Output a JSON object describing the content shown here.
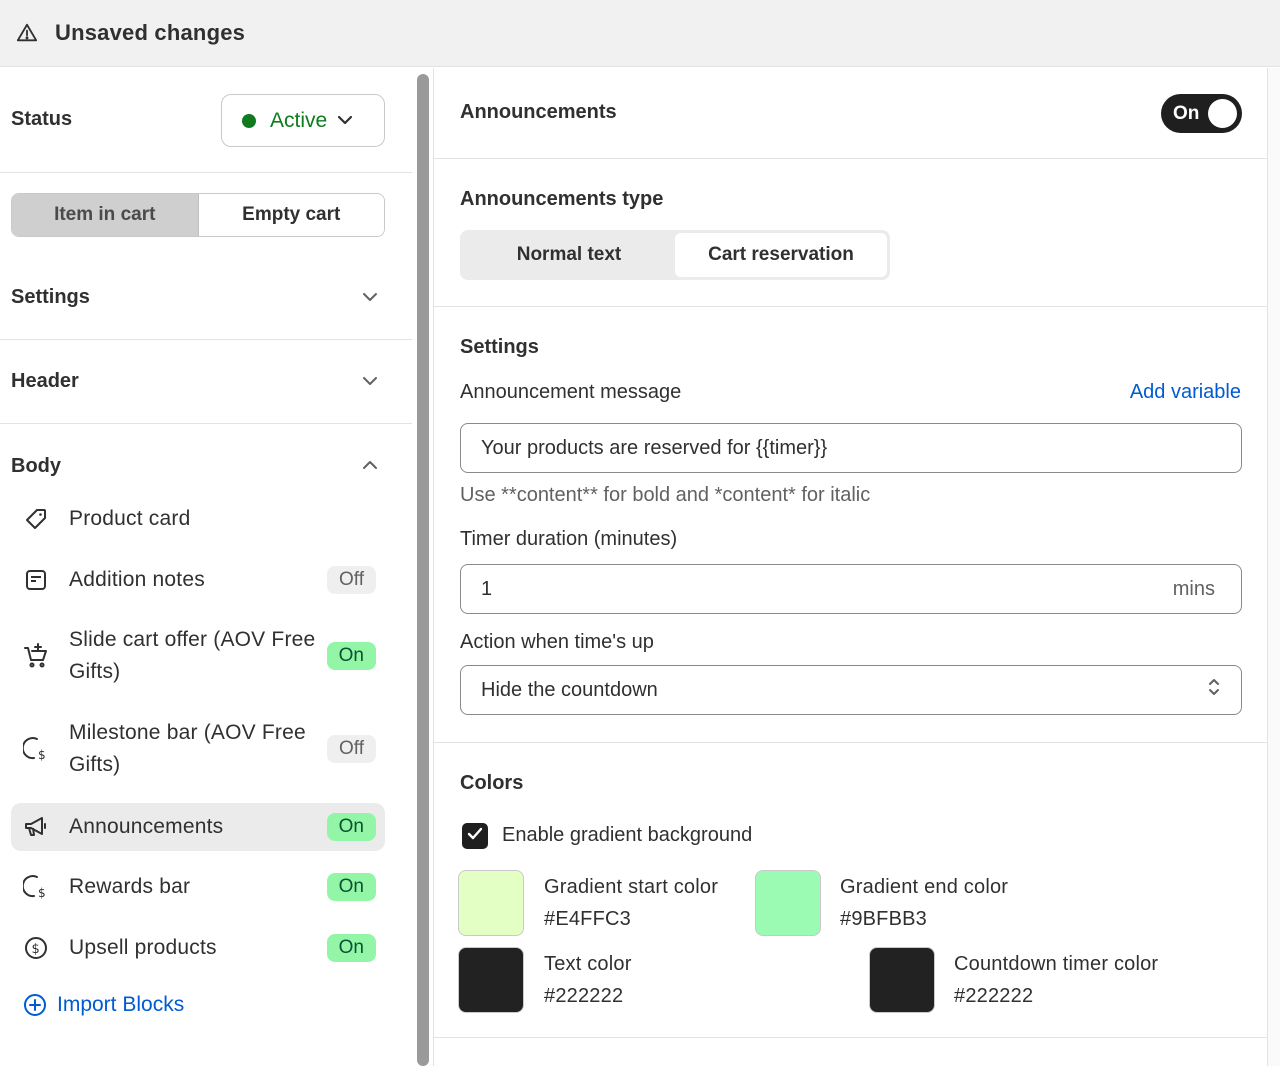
{
  "topbar": {
    "title": "Unsaved changes",
    "icon": "warning-icon"
  },
  "left": {
    "status": {
      "label": "Status",
      "value": "Active",
      "color": "#0e7c1e"
    },
    "cart_tabs": [
      {
        "label": "Item in cart",
        "active": true
      },
      {
        "label": "Empty cart",
        "active": false
      }
    ],
    "sections": {
      "settings": "Settings",
      "header": "Header",
      "body": "Body"
    },
    "items": [
      {
        "label": "Product card",
        "badge": "",
        "icon": "tag-icon"
      },
      {
        "label": "Addition notes",
        "badge": "Off",
        "icon": "note-icon"
      },
      {
        "label": "Slide cart offer (AOV Free Gifts)",
        "badge": "On",
        "icon": "cart-offer-icon"
      },
      {
        "label": "Milestone bar (AOV Free Gifts)",
        "badge": "Off",
        "icon": "milestone-icon"
      },
      {
        "label": "Announcements",
        "badge": "On",
        "icon": "megaphone-icon"
      },
      {
        "label": "Rewards bar",
        "badge": "On",
        "icon": "rewards-icon"
      },
      {
        "label": "Upsell products",
        "badge": "On",
        "icon": "dollar-circle-icon"
      }
    ],
    "import": "Import Blocks"
  },
  "right": {
    "announcements": {
      "title": "Announcements",
      "toggle": "On"
    },
    "type": {
      "title": "Announcements type",
      "options": [
        "Normal text",
        "Cart reservation"
      ],
      "selected": "Cart reservation"
    },
    "settings": {
      "title": "Settings",
      "message_label": "Announcement message",
      "add_variable": "Add variable",
      "message_value": "Your products are reserved for {{timer}}",
      "help": "Use **content** for bold and *content* for italic",
      "timer_label": "Timer duration (minutes)",
      "timer_value": "1",
      "timer_suffix": "mins",
      "action_label": "Action when time's up",
      "action_value": "Hide the countdown"
    },
    "colors": {
      "title": "Colors",
      "gradient_checkbox": "Enable gradient background",
      "gradient_start": {
        "label": "Gradient start color",
        "value": "#E4FFC3",
        "hex": "#E4FFC3"
      },
      "gradient_end": {
        "label": "Gradient end color",
        "value": "#9BFBB3",
        "hex": "#9BFBB3"
      },
      "text": {
        "label": "Text color",
        "value": "#222222",
        "hex": "#222222"
      },
      "countdown": {
        "label": "Countdown timer color",
        "value": "#222222",
        "hex": "#222222"
      }
    }
  }
}
